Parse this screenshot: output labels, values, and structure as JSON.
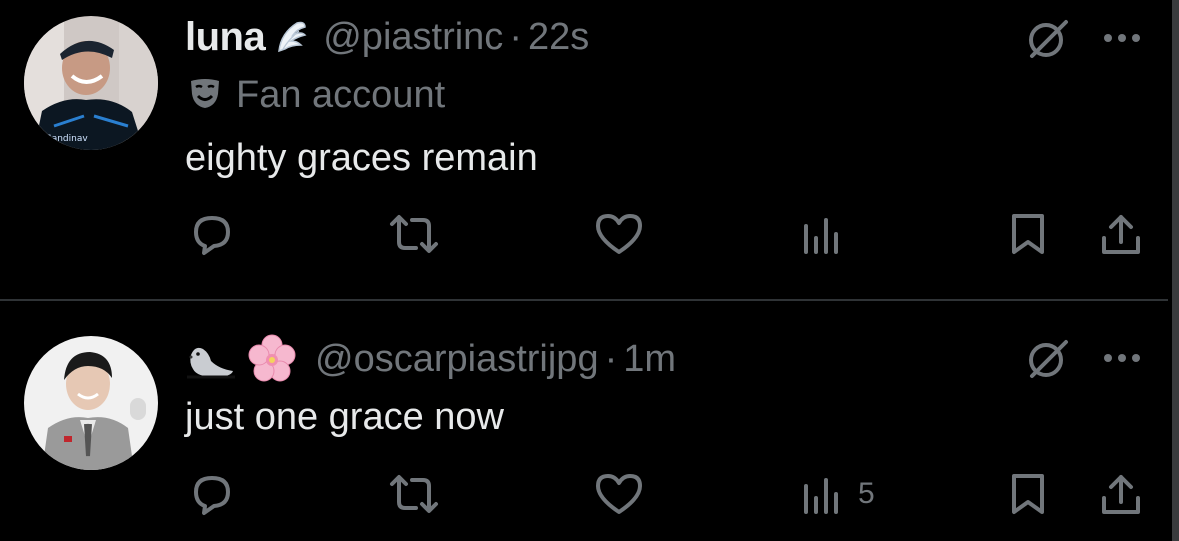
{
  "tweets": [
    {
      "name": "luna",
      "handle": "@piastrinc",
      "separator": "·",
      "time": "22s",
      "label": "Fan account",
      "text": "eighty graces remain",
      "views": ""
    },
    {
      "name": "",
      "handle": "@oscarpiastrijpg",
      "separator": "·",
      "time": "1m",
      "text": "just one grace now",
      "views": "5"
    }
  ],
  "colors": {
    "background": "#000000",
    "text": "#e7e9ea",
    "muted": "#71767b",
    "divider": "#2f3336"
  },
  "icons": [
    "wing-emoji-icon",
    "mask-label-icon",
    "seal-emoji-icon",
    "cherry-blossom-emoji-icon",
    "reply-icon",
    "repost-icon",
    "like-icon",
    "views-icon",
    "bookmark-icon",
    "share-icon",
    "grok-icon",
    "more-icon"
  ]
}
